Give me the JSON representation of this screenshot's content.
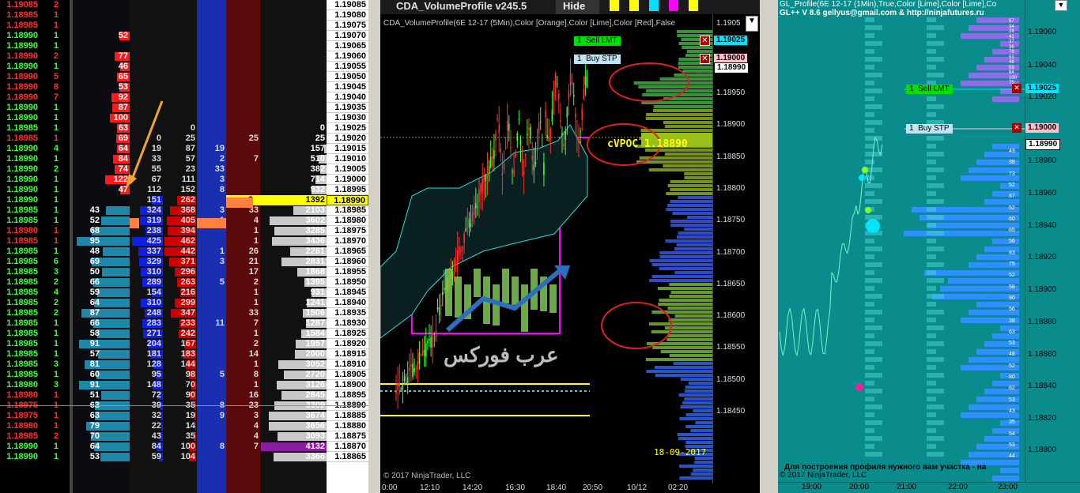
{
  "ladder": {
    "rows": [
      {
        "ltp": "1.19085",
        "vol": "2",
        "lc": "#ff3030",
        "bid_sz": "",
        "ask_sz": "",
        "c1": "",
        "c2": "",
        "c3": "",
        "c4": "",
        "c5": "",
        "price": "1.19085"
      },
      {
        "ltp": "1.18985",
        "vol": "1",
        "lc": "#ff3030",
        "bid_sz": "",
        "ask_sz": "",
        "c1": "",
        "c2": "",
        "c3": "",
        "c4": "",
        "c5": "",
        "price": "1.19080"
      },
      {
        "ltp": "1.18985",
        "vol": "1",
        "lc": "#ff3030",
        "bid_sz": "",
        "ask_sz": "",
        "c1": "",
        "c2": "",
        "c3": "",
        "c4": "",
        "c5": "",
        "price": "1.19075"
      },
      {
        "ltp": "1.18990",
        "vol": "1",
        "lc": "#40ff40",
        "bid_sz": "",
        "ask_sz": "52",
        "c1": "",
        "c2": "",
        "c3": "",
        "c4": "",
        "c5": "",
        "price": "1.19070"
      },
      {
        "ltp": "1.18990",
        "vol": "1",
        "lc": "#40ff40",
        "bid_sz": "",
        "ask_sz": "",
        "c1": "",
        "c2": "",
        "c3": "",
        "c4": "",
        "c5": "",
        "price": "1.19065"
      },
      {
        "ltp": "1.18990",
        "vol": "2",
        "lc": "#ff3030",
        "bid_sz": "",
        "ask_sz": "77",
        "c1": "",
        "c2": "",
        "c3": "",
        "c4": "",
        "c5": "",
        "price": "1.19060"
      },
      {
        "ltp": "1.18990",
        "vol": "1",
        "lc": "#40ff40",
        "bid_sz": "",
        "ask_sz": "46",
        "c1": "",
        "c2": "",
        "c3": "",
        "c4": "",
        "c5": "",
        "price": "1.19055"
      },
      {
        "ltp": "1.18990",
        "vol": "5",
        "lc": "#ff3030",
        "bid_sz": "",
        "ask_sz": "65",
        "c1": "",
        "c2": "",
        "c3": "",
        "c4": "",
        "c5": "",
        "price": "1.19050"
      },
      {
        "ltp": "1.18990",
        "vol": "8",
        "lc": "#ff3030",
        "bid_sz": "",
        "ask_sz": "53",
        "c1": "",
        "c2": "",
        "c3": "",
        "c4": "",
        "c5": "",
        "price": "1.19045"
      },
      {
        "ltp": "1.18990",
        "vol": "7",
        "lc": "#ff3030",
        "bid_sz": "",
        "ask_sz": "92",
        "c1": "",
        "c2": "",
        "c3": "",
        "c4": "",
        "c5": "",
        "price": "1.19040"
      },
      {
        "ltp": "1.18990",
        "vol": "1",
        "lc": "#40ff40",
        "bid_sz": "",
        "ask_sz": "87",
        "c1": "",
        "c2": "",
        "c3": "",
        "c4": "",
        "c5": "",
        "price": "1.19035"
      },
      {
        "ltp": "1.18990",
        "vol": "1",
        "lc": "#40ff40",
        "bid_sz": "",
        "ask_sz": "100",
        "c1": "",
        "c2": "",
        "c3": "",
        "c4": "",
        "c5": "",
        "price": "1.19030"
      },
      {
        "ltp": "1.18985",
        "vol": "1",
        "lc": "#40ff40",
        "bid_sz": "",
        "ask_sz": "63",
        "c1": "",
        "c2": "0",
        "c3": "",
        "c4": "",
        "c5": "0",
        "price": "1.19025"
      },
      {
        "ltp": "1.18985",
        "vol": "1",
        "lc": "#ff3030",
        "bid_sz": "",
        "ask_sz": "69",
        "c1": "0",
        "c2": "25",
        "c3": "",
        "c4": "25",
        "c5": "25",
        "price": "1.19020"
      },
      {
        "ltp": "1.18990",
        "vol": "4",
        "lc": "#40ff40",
        "bid_sz": "",
        "ask_sz": "64",
        "c1": "19",
        "c2": "87",
        "c3": "19",
        "c4": "",
        "c5": "157",
        "price": "1.19015"
      },
      {
        "ltp": "1.18990",
        "vol": "1",
        "lc": "#40ff40",
        "bid_sz": "",
        "ask_sz": "84",
        "c1": "33",
        "c2": "57",
        "c3": "2",
        "c4": "7",
        "c5": "510",
        "price": "1.19010"
      },
      {
        "ltp": "1.18990",
        "vol": "2",
        "lc": "#40ff40",
        "bid_sz": "",
        "ask_sz": "74",
        "c1": "55",
        "c2": "23",
        "c3": "33",
        "c4": "",
        "c5": "382",
        "price": "1.19005"
      },
      {
        "ltp": "1.18990",
        "vol": "1",
        "lc": "#40ff40",
        "bid_sz": "",
        "ask_sz": "122",
        "c1": "67",
        "c2": "111",
        "c3": "3",
        "c4": "",
        "c5": "714",
        "price": "1.19000"
      },
      {
        "ltp": "1.18990",
        "vol": "1",
        "lc": "#40ff40",
        "bid_sz": "",
        "ask_sz": "47",
        "c1": "112",
        "c2": "152",
        "c3": "8",
        "c4": "",
        "c5": "932",
        "price": "1.18995"
      },
      {
        "ltp": "1.18990",
        "vol": "1",
        "lc": "#40ff40",
        "bid_sz": "",
        "ask_sz": "",
        "c1": "151",
        "c2": "262",
        "c3": "",
        "c4": "2",
        "c5": "1392",
        "price": "1.18990"
      },
      {
        "ltp": "1.18985",
        "vol": "1",
        "lc": "#40ff40",
        "bid_sz": "43",
        "ask_sz": "",
        "c1": "324",
        "c2": "368",
        "c3": "3",
        "c4": "33",
        "c5": "2103",
        "price": "1.18985"
      },
      {
        "ltp": "1.18985",
        "vol": "1",
        "lc": "#40ff40",
        "bid_sz": "52",
        "ask_sz": "",
        "c1": "319",
        "c2": "405",
        "c3": "1",
        "c4": "4",
        "c5": "3602",
        "price": "1.18980"
      },
      {
        "ltp": "1.18980",
        "vol": "1",
        "lc": "#ff3030",
        "bid_sz": "68",
        "ask_sz": "",
        "c1": "238",
        "c2": "394",
        "c3": "",
        "c4": "1",
        "c5": "3285",
        "price": "1.18975"
      },
      {
        "ltp": "1.18985",
        "vol": "1",
        "lc": "#ff3030",
        "bid_sz": "95",
        "ask_sz": "",
        "c1": "425",
        "c2": "462",
        "c3": "",
        "c4": "1",
        "c5": "3436",
        "price": "1.18970"
      },
      {
        "ltp": "1.18985",
        "vol": "1",
        "lc": "#40ff40",
        "bid_sz": "48",
        "ask_sz": "",
        "c1": "337",
        "c2": "442",
        "c3": "1",
        "c4": "26",
        "c5": "2281",
        "price": "1.18965"
      },
      {
        "ltp": "1.18985",
        "vol": "6",
        "lc": "#40ff40",
        "bid_sz": "69",
        "ask_sz": "",
        "c1": "329",
        "c2": "371",
        "c3": "3",
        "c4": "21",
        "c5": "2831",
        "price": "1.18960"
      },
      {
        "ltp": "1.18985",
        "vol": "3",
        "lc": "#40ff40",
        "bid_sz": "50",
        "ask_sz": "",
        "c1": "310",
        "c2": "296",
        "c3": "",
        "c4": "17",
        "c5": "1868",
        "price": "1.18955"
      },
      {
        "ltp": "1.18985",
        "vol": "2",
        "lc": "#40ff40",
        "bid_sz": "66",
        "ask_sz": "",
        "c1": "289",
        "c2": "263",
        "c3": "5",
        "c4": "2",
        "c5": "1395",
        "price": "1.18950"
      },
      {
        "ltp": "1.18985",
        "vol": "4",
        "lc": "#40ff40",
        "bid_sz": "59",
        "ask_sz": "",
        "c1": "154",
        "c2": "216",
        "c3": "",
        "c4": "1",
        "c5": "931",
        "price": "1.18945"
      },
      {
        "ltp": "1.18985",
        "vol": "2",
        "lc": "#40ff40",
        "bid_sz": "64",
        "ask_sz": "",
        "c1": "310",
        "c2": "299",
        "c3": "",
        "c4": "1",
        "c5": "1241",
        "price": "1.18940"
      },
      {
        "ltp": "1.18985",
        "vol": "2",
        "lc": "#40ff40",
        "bid_sz": "87",
        "ask_sz": "",
        "c1": "248",
        "c2": "347",
        "c3": "",
        "c4": "33",
        "c5": "1506",
        "price": "1.18935"
      },
      {
        "ltp": "1.18985",
        "vol": "1",
        "lc": "#40ff40",
        "bid_sz": "66",
        "ask_sz": "",
        "c1": "283",
        "c2": "233",
        "c3": "11",
        "c4": "7",
        "c5": "1287",
        "price": "1.18930"
      },
      {
        "ltp": "1.18985",
        "vol": "1",
        "lc": "#40ff40",
        "bid_sz": "58",
        "ask_sz": "",
        "c1": "271",
        "c2": "242",
        "c3": "",
        "c4": "1",
        "c5": "1584",
        "price": "1.18925"
      },
      {
        "ltp": "1.18985",
        "vol": "1",
        "lc": "#40ff40",
        "bid_sz": "91",
        "ask_sz": "",
        "c1": "204",
        "c2": "167",
        "c3": "",
        "c4": "2",
        "c5": "1957",
        "price": "1.18920"
      },
      {
        "ltp": "1.18985",
        "vol": "1",
        "lc": "#40ff40",
        "bid_sz": "57",
        "ask_sz": "",
        "c1": "181",
        "c2": "183",
        "c3": "",
        "c4": "14",
        "c5": "2000",
        "price": "1.18915"
      },
      {
        "ltp": "1.18985",
        "vol": "3",
        "lc": "#40ff40",
        "bid_sz": "81",
        "ask_sz": "",
        "c1": "128",
        "c2": "144",
        "c3": "",
        "c4": "1",
        "c5": "3052",
        "price": "1.18910"
      },
      {
        "ltp": "1.18985",
        "vol": "1",
        "lc": "#40ff40",
        "bid_sz": "60",
        "ask_sz": "",
        "c1": "95",
        "c2": "98",
        "c3": "5",
        "c4": "8",
        "c5": "2720",
        "price": "1.18905"
      },
      {
        "ltp": "1.18980",
        "vol": "3",
        "lc": "#40ff40",
        "bid_sz": "91",
        "ask_sz": "",
        "c1": "148",
        "c2": "70",
        "c3": "",
        "c4": "1",
        "c5": "3126",
        "price": "1.18900"
      },
      {
        "ltp": "1.18980",
        "vol": "1",
        "lc": "#ff3030",
        "bid_sz": "51",
        "ask_sz": "",
        "c1": "72",
        "c2": "90",
        "c3": "",
        "c4": "16",
        "c5": "2845",
        "price": "1.18895"
      },
      {
        "ltp": "1.18975",
        "vol": "1",
        "lc": "#ff3030",
        "bid_sz": "63",
        "ask_sz": "",
        "c1": "39",
        "c2": "35",
        "c3": "8",
        "c4": "23",
        "c5": "3309",
        "price": "1.18890"
      },
      {
        "ltp": "1.18975",
        "vol": "1",
        "lc": "#ff3030",
        "bid_sz": "63",
        "ask_sz": "",
        "c1": "32",
        "c2": "19",
        "c3": "9",
        "c4": "3",
        "c5": "3674",
        "price": "1.18885"
      },
      {
        "ltp": "1.18980",
        "vol": "1",
        "lc": "#ff3030",
        "bid_sz": "79",
        "ask_sz": "",
        "c1": "22",
        "c2": "14",
        "c3": "",
        "c4": "4",
        "c5": "3656",
        "price": "1.18880"
      },
      {
        "ltp": "1.18985",
        "vol": "2",
        "lc": "#ff3030",
        "bid_sz": "70",
        "ask_sz": "",
        "c1": "43",
        "c2": "35",
        "c3": "",
        "c4": "4",
        "c5": "3093",
        "price": "1.18875"
      },
      {
        "ltp": "1.18990",
        "vol": "1",
        "lc": "#40ff40",
        "bid_sz": "64",
        "ask_sz": "",
        "c1": "84",
        "c2": "100",
        "c3": "8",
        "c4": "7",
        "c5": "4132",
        "price": "1.18870"
      },
      {
        "ltp": "1.18990",
        "vol": "1",
        "lc": "#40ff40",
        "bid_sz": "53",
        "ask_sz": "",
        "c1": "59",
        "c2": "104",
        "c3": "",
        "c4": "",
        "c5": "3366",
        "price": "1.18865"
      }
    ],
    "current_price": "1.18990",
    "current_volume": "2"
  },
  "chart": {
    "tab_title": "CDA_VolumeProfile v245.5",
    "hide_label": "Hide",
    "indicator_caption": "CDA_VolumeProfile(6E 12-17 (5Min),Color [Orange],Color [Lime],Color [Red],False",
    "sell_lmt": {
      "qty": "1",
      "label": "Sell LMT",
      "price": "1.19025"
    },
    "buy_stp": {
      "qty": "1",
      "label": "Buy STP",
      "price": "1.19000"
    },
    "last_price": "1.18990",
    "vpoc_label": "cVPOC 1.18890",
    "date_label": "18-09-2017",
    "copyright": "© 2017 NinjaTrader, LLC",
    "y_ticks": [
      "1.18950",
      "1.18900",
      "1.18850",
      "1.18800",
      "1.18750",
      "1.18700",
      "1.18650",
      "1.18600",
      "1.18550",
      "1.18500",
      "1.18450"
    ],
    "top_tick": "1.1905",
    "x_ticks": [
      "0:00",
      "12:10",
      "14:20",
      "16:30",
      "18:40",
      "20:50",
      "10/12",
      "02:20"
    ],
    "watermark": "عرب فوركس"
  },
  "right": {
    "title_line1": "GL_Profile(6E 12-17 (1Min),True,Color [Lime],Color [Lime],Co",
    "title_line2": "GL++ V 8.6 gellyus@gmail.com & http://ninjafutures.ru",
    "sell_lmt": {
      "qty": "1",
      "label": "Sell LMT",
      "price": "1.19025"
    },
    "buy_stp": {
      "qty": "1",
      "label": "Buy STP",
      "price": "1.19000"
    },
    "last_price": "1.18990",
    "y_ticks": [
      "1.19060",
      "1.19040",
      "1.19020",
      "1.18980",
      "1.18960",
      "1.18940",
      "1.18920",
      "1.18900",
      "1.18880",
      "1.18860",
      "1.18840",
      "1.18820",
      "1.18800"
    ],
    "x_ticks": [
      "19:00",
      "20:00",
      "21:00",
      "22:00",
      "23:00"
    ],
    "russian_note": "Для построения профиля нужного вам участка - на",
    "copyright": "© 2017 NinjaTrader, LLC",
    "top_counts": [
      "67",
      "34",
      "28",
      "41",
      "37",
      "36",
      "78",
      "53",
      "48",
      "59",
      "84",
      "100",
      "75"
    ],
    "low_counts": [
      "43",
      "38",
      "73",
      "52",
      "87",
      "52",
      "60",
      "65",
      "56",
      "83",
      "75",
      "52",
      "58",
      "90",
      "56",
      "38",
      "63",
      "53",
      "48",
      "52",
      "80",
      "62",
      "53",
      "43",
      "35",
      "54",
      "53",
      "44"
    ]
  },
  "colors": {
    "bid": "#1e88e5",
    "ask": "#ff1a1a",
    "sell_lmt": "#00e000",
    "buy_stp": "#bfe4f4",
    "price_highlight": "#ffff00"
  }
}
